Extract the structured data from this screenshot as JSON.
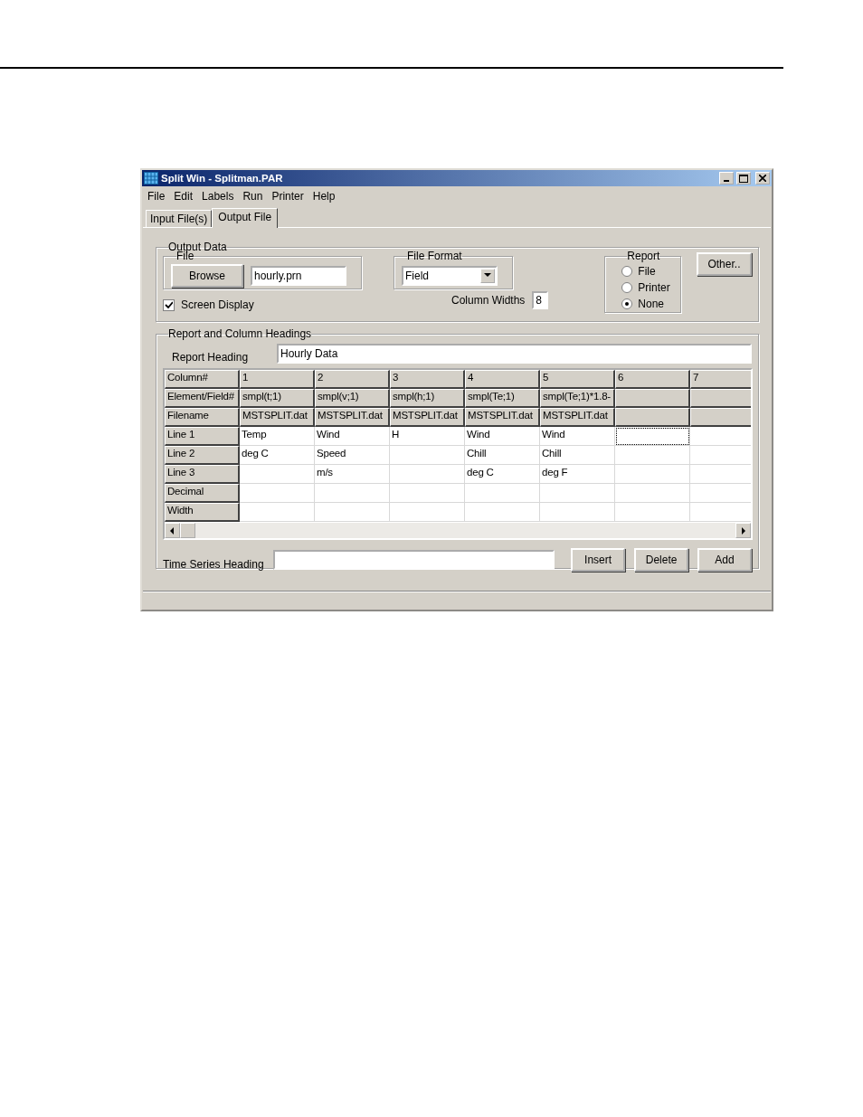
{
  "window": {
    "title": "Split Win - Splitman.PAR"
  },
  "menu": [
    {
      "label": "File"
    },
    {
      "label": "Edit"
    },
    {
      "label": "Labels"
    },
    {
      "label": "Run"
    },
    {
      "label": "Printer"
    },
    {
      "label": "Help"
    }
  ],
  "tabs": [
    {
      "label": "Input File(s)",
      "selected": false
    },
    {
      "label": "Output File",
      "selected": true
    }
  ],
  "output_data": {
    "title": "Output Data",
    "file_group": {
      "title": "File",
      "browse_button": "Browse",
      "filename": "hourly.prn"
    },
    "screen_display": {
      "label": "Screen Display",
      "checked": true
    },
    "file_format": {
      "title": "File Format",
      "value": "Field"
    },
    "column_widths": {
      "label": "Column Widths",
      "value": "8"
    },
    "report": {
      "title": "Report",
      "options": [
        {
          "label": "File",
          "selected": false
        },
        {
          "label": "Printer",
          "selected": false
        },
        {
          "label": "None",
          "selected": true
        }
      ]
    },
    "other_button": "Other.."
  },
  "headings": {
    "title": "Report and Column Headings",
    "report_heading": {
      "label": "Report Heading",
      "value": "Hourly Data"
    },
    "grid": {
      "rows": [
        {
          "kind": "fixed",
          "header": "Column#",
          "cells": [
            "1",
            "2",
            "3",
            "4",
            "5",
            "6",
            "7"
          ]
        },
        {
          "kind": "fixed",
          "header": "Element/Field#",
          "cells": [
            "smpl(t;1)",
            "smpl(v;1)",
            "smpl(h;1)",
            "smpl(Te;1)",
            "smpl(Te;1)*1.8-",
            null,
            null
          ]
        },
        {
          "kind": "fixed",
          "header": "Filename",
          "cells": [
            "MSTSPLIT.dat",
            "MSTSPLIT.dat",
            "MSTSPLIT.dat",
            "MSTSPLIT.dat",
            "MSTSPLIT.dat",
            null,
            null
          ]
        },
        {
          "kind": "entry",
          "header": "Line 1",
          "cells": [
            {
              "text": "Temp",
              "focused": false
            },
            {
              "text": "Wind",
              "focused": false
            },
            {
              "text": "H",
              "focused": false
            },
            {
              "text": "Wind",
              "focused": false
            },
            {
              "text": "Wind",
              "focused": false
            },
            {
              "focused": true
            },
            {
              "focused": false
            }
          ]
        },
        {
          "kind": "entry",
          "header": "Line 2",
          "cells": [
            {
              "text": "deg C",
              "focused": false
            },
            {
              "text": "Speed",
              "focused": false
            },
            {
              "focused": false
            },
            {
              "text": "Chill",
              "focused": false
            },
            {
              "text": "Chill",
              "focused": false
            },
            {
              "focused": false
            },
            {
              "focused": false
            }
          ]
        },
        {
          "kind": "entry",
          "header": "Line 3",
          "cells": [
            {
              "focused": false
            },
            {
              "text": "m/s",
              "focused": false
            },
            {
              "focused": false
            },
            {
              "text": "deg C",
              "focused": false
            },
            {
              "text": "deg F",
              "focused": false
            },
            {
              "focused": false
            },
            {
              "focused": false
            }
          ]
        },
        {
          "kind": "entry",
          "header": "Decimal",
          "cells": [
            {
              "focused": false
            },
            {
              "focused": false
            },
            {
              "focused": false
            },
            {
              "focused": false
            },
            {
              "focused": false
            },
            {
              "focused": false
            },
            {
              "focused": false
            }
          ]
        },
        {
          "kind": "entry",
          "header": "Width",
          "cells": [
            {
              "focused": false
            },
            {
              "focused": false
            },
            {
              "focused": false
            },
            {
              "focused": false
            },
            {
              "focused": false
            },
            {
              "focused": false
            },
            {
              "focused": false
            }
          ]
        }
      ]
    },
    "time_series_heading": {
      "label": "Time Series Heading"
    },
    "buttons": [
      "Insert",
      "Delete",
      "Add"
    ]
  }
}
